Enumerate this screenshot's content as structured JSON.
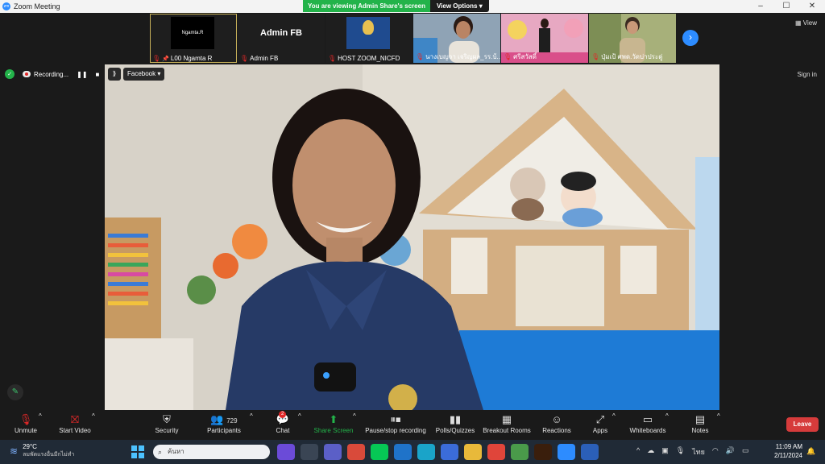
{
  "window": {
    "title": "Zoom Meeting",
    "controls": [
      "–",
      "☐",
      "✕"
    ]
  },
  "share_banner": {
    "status": "You are viewing Admin Share's screen",
    "options_label": "View Options"
  },
  "gallery": {
    "tiles": [
      {
        "name": "L00 Ngamta R",
        "screen_text": "Ngamta.R",
        "kind": "black"
      },
      {
        "name": "Admin FB",
        "screen_text": "Admin FB",
        "kind": "text"
      },
      {
        "name": "HOST ZOOM_NICFD",
        "screen_text": "",
        "kind": "logo"
      },
      {
        "name": "นางเบญจา เจริญผล_รร.บ้..",
        "screen_text": "",
        "kind": "video"
      },
      {
        "name": "ศรีสวัสดิ์",
        "screen_text": "",
        "kind": "video"
      },
      {
        "name": "ปุ่มเป้ ศพด.วัดบ่าประดู่",
        "screen_text": "",
        "kind": "video"
      }
    ],
    "next_icon": "chevron-right-icon",
    "view_label": "View"
  },
  "status": {
    "recording_label": "Recording...",
    "sign_in": "Sign in",
    "stream_target": "Facebook"
  },
  "toolbar": {
    "unmute": "Unmute",
    "start_video": "Start Video",
    "security": "Security",
    "participants": "Participants",
    "participants_count": "729",
    "chat": "Chat",
    "chat_badge": "2",
    "share_screen": "Share Screen",
    "pause_recording": "Pause/stop recording",
    "polls": "Polls/Quizzes",
    "breakout": "Breakout Rooms",
    "reactions": "Reactions",
    "apps": "Apps",
    "whiteboards": "Whiteboards",
    "notes": "Notes",
    "leave": "Leave"
  },
  "taskbar": {
    "temperature": "29°C",
    "weather_text": "ลมพัดแรงอื่นมีกไม่ทำ",
    "search_placeholder": "ค้นหา",
    "language": "ไทย",
    "time": "11:09 AM",
    "date": "2/11/2024"
  },
  "colors": {
    "zoom_blue": "#2d8cff",
    "share_green": "#23b34a",
    "leave_red": "#d63b3b"
  }
}
